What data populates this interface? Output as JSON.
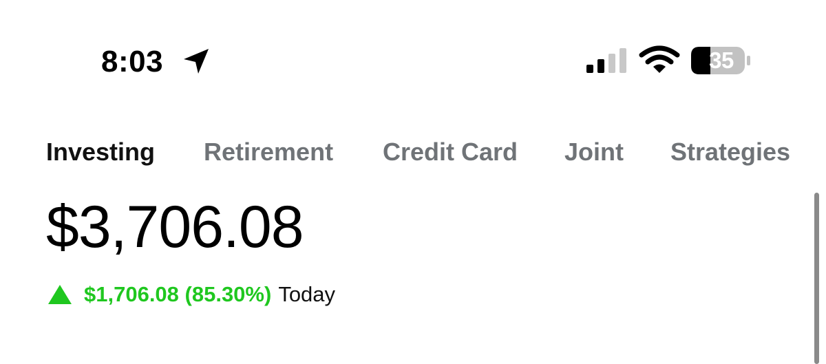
{
  "status_bar": {
    "time": "8:03",
    "battery_level": "35",
    "signal_bars_active": 2,
    "signal_bars_total": 4,
    "icons": [
      "location-arrow-icon",
      "signal-icon",
      "wifi-icon",
      "battery-icon"
    ]
  },
  "tabs": [
    {
      "label": "Investing",
      "active": true
    },
    {
      "label": "Retirement",
      "active": false
    },
    {
      "label": "Credit Card",
      "active": false
    },
    {
      "label": "Joint",
      "active": false
    },
    {
      "label": "Strategies",
      "active": false
    }
  ],
  "portfolio": {
    "balance": "$3,706.08",
    "change": "$1,706.08 (85.30%)",
    "change_period": "Today",
    "direction_icon": "up-triangle-icon"
  },
  "colors": {
    "gain_green": "#1fc71f",
    "tab_inactive": "#6f7377",
    "tab_active": "#111111"
  }
}
